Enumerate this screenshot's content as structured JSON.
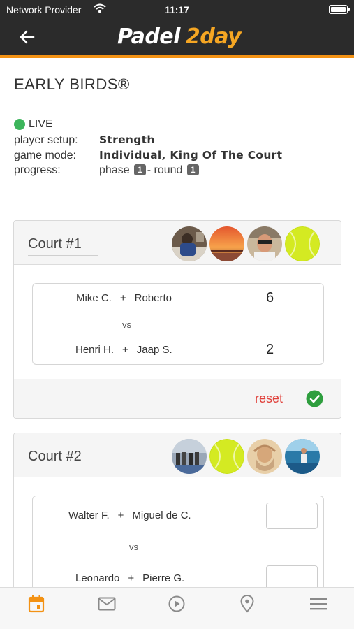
{
  "status_bar": {
    "carrier": "Network Provider",
    "time": "11:17"
  },
  "header": {
    "logo_part1": "Padel",
    "logo_part2": "2day",
    "back_icon": "arrow-left-icon",
    "colors": {
      "bar": "#2b2b2b",
      "accent": "#f39214"
    }
  },
  "event": {
    "title": "EARLY BIRDS®",
    "status": "LIVE",
    "status_color": "#3cb55b",
    "player_setup_label": "player setup:",
    "player_setup_value": "Strength",
    "game_mode_label": "game mode:",
    "game_mode_value": "Individual, King Of The Court",
    "progress_label": "progress:",
    "phase_label": "phase",
    "phase_value": "1",
    "round_label": "- round",
    "round_value": "1"
  },
  "courts": [
    {
      "name": "Court #1",
      "avatars": [
        "player-photo-kitchen",
        "sunset-photo",
        "man-sunglasses-photo",
        "tennis-ball"
      ],
      "team1": {
        "p1": "Mike C.",
        "p2": "Roberto",
        "score": "6"
      },
      "vs": "vs",
      "team2": {
        "p1": "Henri H.",
        "p2": "Jaap S.",
        "score": "2"
      },
      "reset_label": "reset",
      "confirm_icon": "check-circle-icon"
    },
    {
      "name": "Court #2",
      "avatars": [
        "group-photo",
        "tennis-ball",
        "leonardo-portrait",
        "padel-player-photo"
      ],
      "team1": {
        "p1": "Walter F.",
        "p2": "Miguel de C.",
        "score": ""
      },
      "vs": "vs",
      "team2": {
        "p1": "Leonardo",
        "p2": "Pierre G.",
        "score": ""
      }
    }
  ],
  "plus": "+",
  "tabbar": {
    "items": [
      "calendar-icon",
      "mail-icon",
      "play-icon",
      "location-icon",
      "menu-icon"
    ],
    "active_color": "#f39214"
  }
}
